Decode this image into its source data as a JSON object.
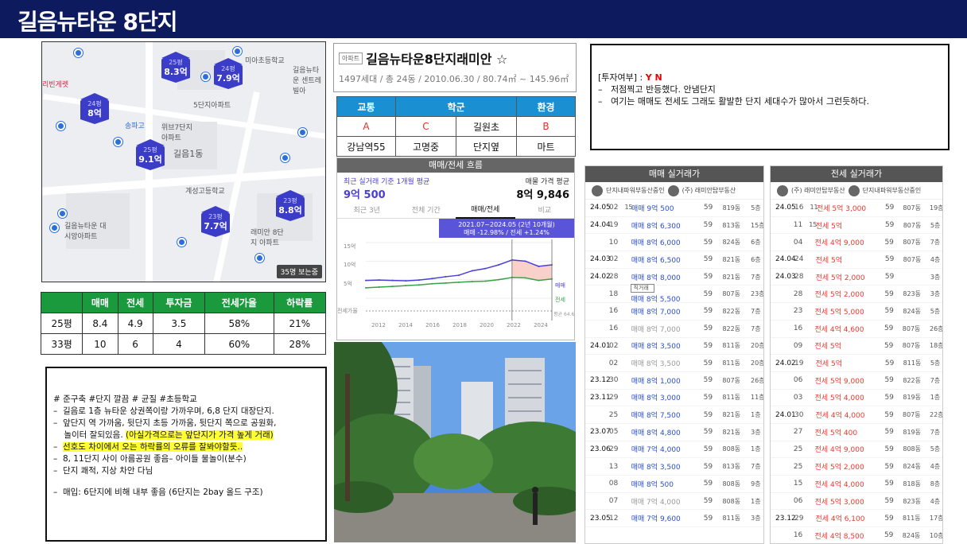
{
  "header": {
    "title": "길음뉴타운 8단지"
  },
  "map": {
    "labels": [
      "미아초등학교",
      "길음뉴타운 센트레빌아",
      "5단지아파트",
      "위브7단지 아파트",
      "길음1동",
      "계성고등학교",
      "길음뉴타운 대시앙아파트",
      "래미안 8단지 아파트",
      "리빈게렛",
      "송파고"
    ],
    "markers": [
      {
        "size": "25평",
        "price": "8.3억"
      },
      {
        "size": "24평",
        "price": "7.9억"
      },
      {
        "size": "24평",
        "price": "8억"
      },
      {
        "size": "25평",
        "price": "9.1억"
      },
      {
        "size": "23평",
        "price": "7.7억"
      },
      {
        "size": "23평",
        "price": "8.8억"
      }
    ],
    "count_label": "35명 보는중"
  },
  "price_table": {
    "headers": [
      "",
      "매매",
      "전세",
      "투자금",
      "전세가율",
      "하락률"
    ],
    "rows": [
      [
        "25평",
        "8.4",
        "4.9",
        "3.5",
        "58%",
        "21%"
      ],
      [
        "33평",
        "10",
        "6",
        "4",
        "60%",
        "28%"
      ]
    ]
  },
  "memo": {
    "tags": "# 준구축 #단지 깔끔 # 균질  #초등학교",
    "lines": [
      "길음로 1층 뉴타운 상권쪽이랑 가까우며, 6,8 단지 대장단지.",
      "앞단지 역 가까움, 뒷단지 초등 가까움, 뒷단지 쪽으로 공원화,",
      "놀이터 잘되있음.",
      "(아실가격으로는 앞단지가 가격 높게 거래)",
      "선호도 차이에서 오는 하락률의 오류를 잘봐야할듯..",
      "8, 11단지 사이 아름공원 좋음– 아이들 물놀이(분수)",
      "단지 쾌적, 지상 차안 다님",
      "매입: 6단지에 비해 내부 좋음 (6단지는 2bay 올드 구조)"
    ]
  },
  "apt": {
    "tag": "아파트",
    "name": "길음뉴타운8단지래미안 ☆",
    "sub": "1497세대 / 총 24동 / 2010.06.30 / 80.74㎡ ~ 145.96㎡"
  },
  "school_table": {
    "headers": [
      "교통",
      "학군",
      "환경"
    ],
    "grade": [
      "A",
      "C",
      "길원초",
      "B"
    ],
    "names": [
      "강남역55",
      "고명중",
      "단지옆",
      "마트"
    ]
  },
  "chart": {
    "header": "매매/전세 흐름",
    "avg_label": "최근 실거래 기준 1개월 평균",
    "avg_value": "9억 500",
    "ask_label": "매물 가격 평균",
    "ask_value": "8억 9,846",
    "tabs": [
      "최근 3년",
      "전체 기간",
      "매매/전세",
      "비교"
    ],
    "tooltip1": "2021.07~2024.05 (2년 10개월)",
    "tooltip2": "매매 -12.98%  /  전세 +1.24%",
    "y_ticks": [
      "15억",
      "10억",
      "5억",
      "전세가율"
    ],
    "x_ticks": [
      "2012",
      "2014",
      "2016",
      "2018",
      "2020",
      "2022",
      "2024"
    ],
    "legend": [
      "매매",
      "전세",
      "평균 64.69"
    ],
    "colors": {
      "sale": "#4a3fd6",
      "jeonse": "#3aa04a",
      "ratio": "#999999"
    }
  },
  "chart_data": {
    "type": "line",
    "x": [
      "2010",
      "2011",
      "2012",
      "2013",
      "2014",
      "2015",
      "2016",
      "2017",
      "2018",
      "2019",
      "2020",
      "2021",
      "2022",
      "2023",
      "2024"
    ],
    "series": [
      {
        "name": "매매",
        "values": [
          4.8,
          4.9,
          4.8,
          4.7,
          4.9,
          5.3,
          5.8,
          6.2,
          7.4,
          8.0,
          9.0,
          10.3,
          10.0,
          8.6,
          9.0
        ]
      },
      {
        "name": "전세",
        "values": [
          2.8,
          3.0,
          3.2,
          3.4,
          3.6,
          3.9,
          4.1,
          4.3,
          4.5,
          4.6,
          5.0,
          5.6,
          5.5,
          4.8,
          5.2
        ]
      }
    ],
    "ylim": [
      0,
      15
    ]
  },
  "info": {
    "label": "[투자여부] : ",
    "yn": "Y N",
    "l1": "저점찍고 반등했다. 안냄단지",
    "l2": "여기는 매매도 전세도 그래도 활발한 단지 세대수가 많아서 그런듯하다."
  },
  "sale": {
    "title": "매매 실거래가",
    "agent1": "단지내파워부동산중인",
    "agent2": "(주) 래미안탑부동산",
    "rows": [
      {
        "d": "24.05",
        "day": "02",
        "x": "15",
        "p": "매매 9억 500",
        "a": "59",
        "u": "819동",
        "f": "5층"
      },
      {
        "d": "24.04",
        "day": "19",
        "p": "매매 8억 6,300",
        "a": "59",
        "u": "813동",
        "f": "15층"
      },
      {
        "d": "",
        "day": "10",
        "p": "매매 8억 6,000",
        "a": "59",
        "u": "824동",
        "f": "6층"
      },
      {
        "d": "24.03",
        "day": "02",
        "p": "매매 8억 6,500",
        "a": "59",
        "u": "821동",
        "f": "6층"
      },
      {
        "d": "24.02",
        "day": "28",
        "p": "매매 8억 8,000",
        "a": "59",
        "u": "821동",
        "f": "7층"
      },
      {
        "d": "",
        "day": "18",
        "tag": "직거래",
        "p": "매매 8억 5,500",
        "a": "59",
        "u": "807동",
        "f": "23층"
      },
      {
        "d": "",
        "day": "16",
        "p": "매매 8억 7,000",
        "a": "59",
        "u": "822동",
        "f": "7층"
      },
      {
        "d": "",
        "day": "16",
        "p": "매매 8억 7,000",
        "a": "59",
        "u": "822동",
        "f": "7층",
        "g": true
      },
      {
        "d": "24.01",
        "day": "02",
        "p": "매매 8억 3,500",
        "a": "59",
        "u": "811동",
        "f": "20층"
      },
      {
        "d": "",
        "day": "02",
        "p": "매매 8억 3,500",
        "a": "59",
        "u": "811동",
        "f": "20층",
        "g": true
      },
      {
        "d": "23.12",
        "day": "30",
        "p": "매매 8억 1,000",
        "a": "59",
        "u": "807동",
        "f": "26층"
      },
      {
        "d": "23.11",
        "day": "29",
        "p": "매매 8억 3,000",
        "a": "59",
        "u": "811동",
        "f": "11층"
      },
      {
        "d": "",
        "day": "25",
        "p": "매매 8억 7,500",
        "a": "59",
        "u": "821동",
        "f": "1층"
      },
      {
        "d": "23.07",
        "day": "05",
        "p": "매매 8억 4,800",
        "a": "59",
        "u": "821동",
        "f": "3층"
      },
      {
        "d": "23.06",
        "day": "29",
        "p": "매매 7억 4,000",
        "a": "59",
        "u": "808동",
        "f": "1층"
      },
      {
        "d": "",
        "day": "13",
        "p": "매매 8억 3,500",
        "a": "59",
        "u": "813동",
        "f": "7층"
      },
      {
        "d": "",
        "day": "08",
        "p": "매매 8억 500",
        "a": "59",
        "u": "808동",
        "f": "9층"
      },
      {
        "d": "",
        "day": "07",
        "p": "매매 7억 4,000",
        "a": "59",
        "u": "808동",
        "f": "1층",
        "g": true
      },
      {
        "d": "23.05",
        "day": "12",
        "p": "매매 7억 9,600",
        "a": "59",
        "u": "811동",
        "f": "3층"
      }
    ]
  },
  "jeonse": {
    "title": "전세 실거래가",
    "agent1": "(주) 래미안탑부동산",
    "agent2": "단지내파워부동산중인",
    "rows": [
      {
        "d": "24.05",
        "day": "16",
        "x": "11",
        "p": "전세 5억 3,000",
        "a": "59",
        "u": "807동",
        "f": "19층"
      },
      {
        "d": "",
        "day": "11",
        "x": "15",
        "p": "전세 5억",
        "a": "59",
        "u": "807동",
        "f": "5층"
      },
      {
        "d": "",
        "day": "04",
        "p": "전세 4억 9,000",
        "a": "59",
        "u": "807동",
        "f": "7층"
      },
      {
        "d": "24.04",
        "day": "24",
        "p": "전세 5억",
        "a": "59",
        "u": "807동",
        "f": "4층"
      },
      {
        "d": "24.03",
        "day": "28",
        "p": "전세 5억 2,000",
        "a": "59",
        "u": "",
        "f": "3층"
      },
      {
        "d": "",
        "day": "28",
        "p": "전세 5억 2,000",
        "a": "59",
        "u": "823동",
        "f": "3층"
      },
      {
        "d": "",
        "day": "23",
        "p": "전세 5억 5,000",
        "a": "59",
        "u": "824동",
        "f": "5층"
      },
      {
        "d": "",
        "day": "16",
        "p": "전세 4억 4,600",
        "a": "59",
        "u": "807동",
        "f": "26층"
      },
      {
        "d": "",
        "day": "09",
        "p": "전세 5억",
        "a": "59",
        "u": "807동",
        "f": "18층"
      },
      {
        "d": "24.02",
        "day": "19",
        "p": "전세 5억",
        "a": "59",
        "u": "811동",
        "f": "5층"
      },
      {
        "d": "",
        "day": "06",
        "p": "전세 5억 9,000",
        "a": "59",
        "u": "822동",
        "f": "7층"
      },
      {
        "d": "",
        "day": "03",
        "p": "전세 5억 4,000",
        "a": "59",
        "u": "819동",
        "f": "1층"
      },
      {
        "d": "24.01",
        "day": "30",
        "p": "전세 4억 4,000",
        "a": "59",
        "u": "807동",
        "f": "22층"
      },
      {
        "d": "",
        "day": "27",
        "p": "전세 5억 400",
        "a": "59",
        "u": "819동",
        "f": "7층"
      },
      {
        "d": "",
        "day": "25",
        "p": "전세 4억 9,000",
        "a": "59",
        "u": "808동",
        "f": "5층"
      },
      {
        "d": "",
        "day": "25",
        "p": "전세 5억 2,000",
        "a": "59",
        "u": "824동",
        "f": "4층"
      },
      {
        "d": "",
        "day": "15",
        "p": "전세 4억 4,000",
        "a": "59",
        "u": "818동",
        "f": "8층"
      },
      {
        "d": "",
        "day": "06",
        "p": "전세 5억 3,000",
        "a": "59",
        "u": "823동",
        "f": "4층"
      },
      {
        "d": "23.12",
        "day": "29",
        "p": "전세 4억 6,100",
        "a": "59",
        "u": "811동",
        "f": "17층"
      },
      {
        "d": "",
        "day": "16",
        "p": "전세 4억 8,500",
        "a": "59",
        "u": "824동",
        "f": "10층"
      }
    ]
  }
}
